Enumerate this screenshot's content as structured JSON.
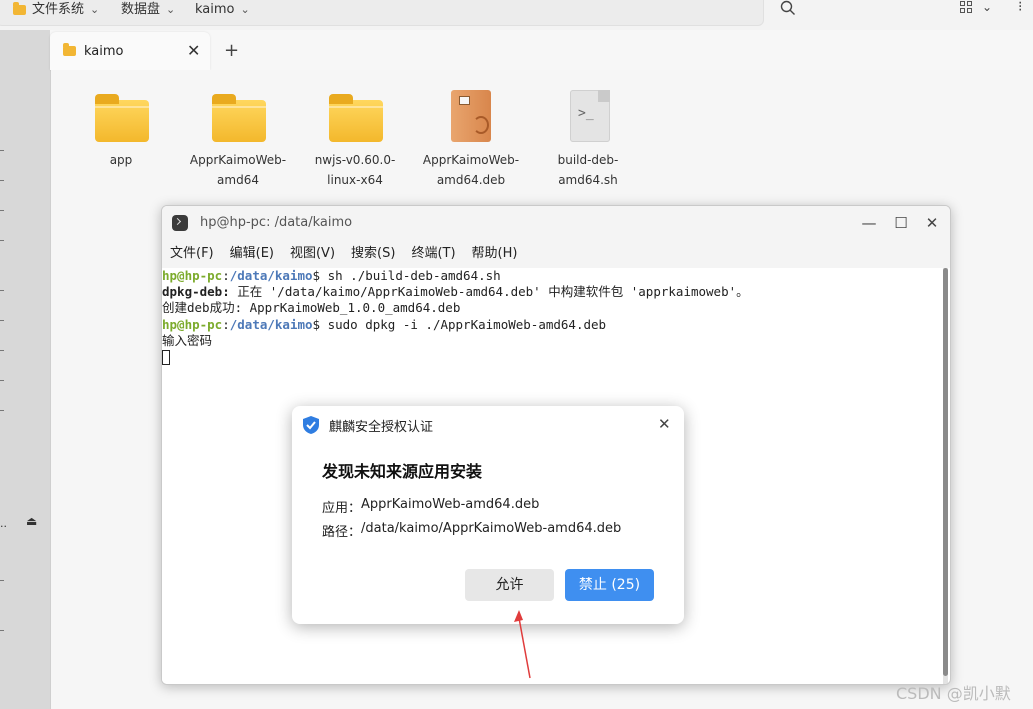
{
  "pathbar": {
    "crumbs": [
      "文件系统",
      "数据盘",
      "kaimo"
    ],
    "chevron": "⌄",
    "icons": [
      "folder-icon",
      "search-icon",
      "grid-view-icon",
      "chevron-down-icon",
      "more-icon"
    ]
  },
  "tabs": [
    {
      "label": "kaimo",
      "close": "✕"
    }
  ],
  "new_tab": "+",
  "files": [
    {
      "name": "app",
      "icon": "folder-icon"
    },
    {
      "name": "ApprKaimoWeb-\namd64",
      "icon": "folder-icon"
    },
    {
      "name": "nwjs-v0.60.0-\nlinux-x64",
      "icon": "folder-icon"
    },
    {
      "name": "ApprKaimoWeb-\namd64.deb",
      "icon": "deb-package-icon"
    },
    {
      "name": "build-deb-\namd64.sh",
      "icon": "shell-script-icon"
    }
  ],
  "terminal": {
    "title": "hp@hp-pc: /data/kaimo",
    "menu": [
      "文件(F)",
      "编辑(E)",
      "视图(V)",
      "搜索(S)",
      "终端(T)",
      "帮助(H)"
    ],
    "lines": [
      {
        "user": "hp@hp-pc",
        "sep": ":",
        "path": "/data/kaimo",
        "cmd": "$ sh ./build-deb-amd64.sh"
      },
      {
        "bold": "dpkg-deb:",
        "text": " 正在 '/data/kaimo/ApprKaimoWeb-amd64.deb' 中构建软件包 'apprkaimoweb'。"
      },
      {
        "text": "创建deb成功: ApprKaimoWeb_1.0.0_amd64.deb"
      },
      {
        "user": "hp@hp-pc",
        "sep": ":",
        "path": "/data/kaimo",
        "cmd": "$ sudo dpkg -i ./ApprKaimoWeb-amd64.deb"
      },
      {
        "text": "输入密码"
      }
    ],
    "window_buttons": {
      "minimize": "—",
      "maximize": "☐",
      "close": "✕"
    }
  },
  "dialog": {
    "header": "麒麟安全授权认证",
    "title": "发现未知来源应用安装",
    "app_label": "应用：",
    "app_value": "ApprKaimoWeb-amd64.deb",
    "path_label": "路径：",
    "path_value": "/data/kaimo/ApprKaimoWeb-amd64.deb",
    "allow_label": "允许",
    "deny_label": "禁止 (25)",
    "close": "✕"
  },
  "watermark": "CSDN @凯小默",
  "colors": {
    "accent": "#3f8ff0",
    "prompt_user": "#7cab2c",
    "prompt_path": "#4d79b8",
    "folder": "#f3b82c"
  }
}
